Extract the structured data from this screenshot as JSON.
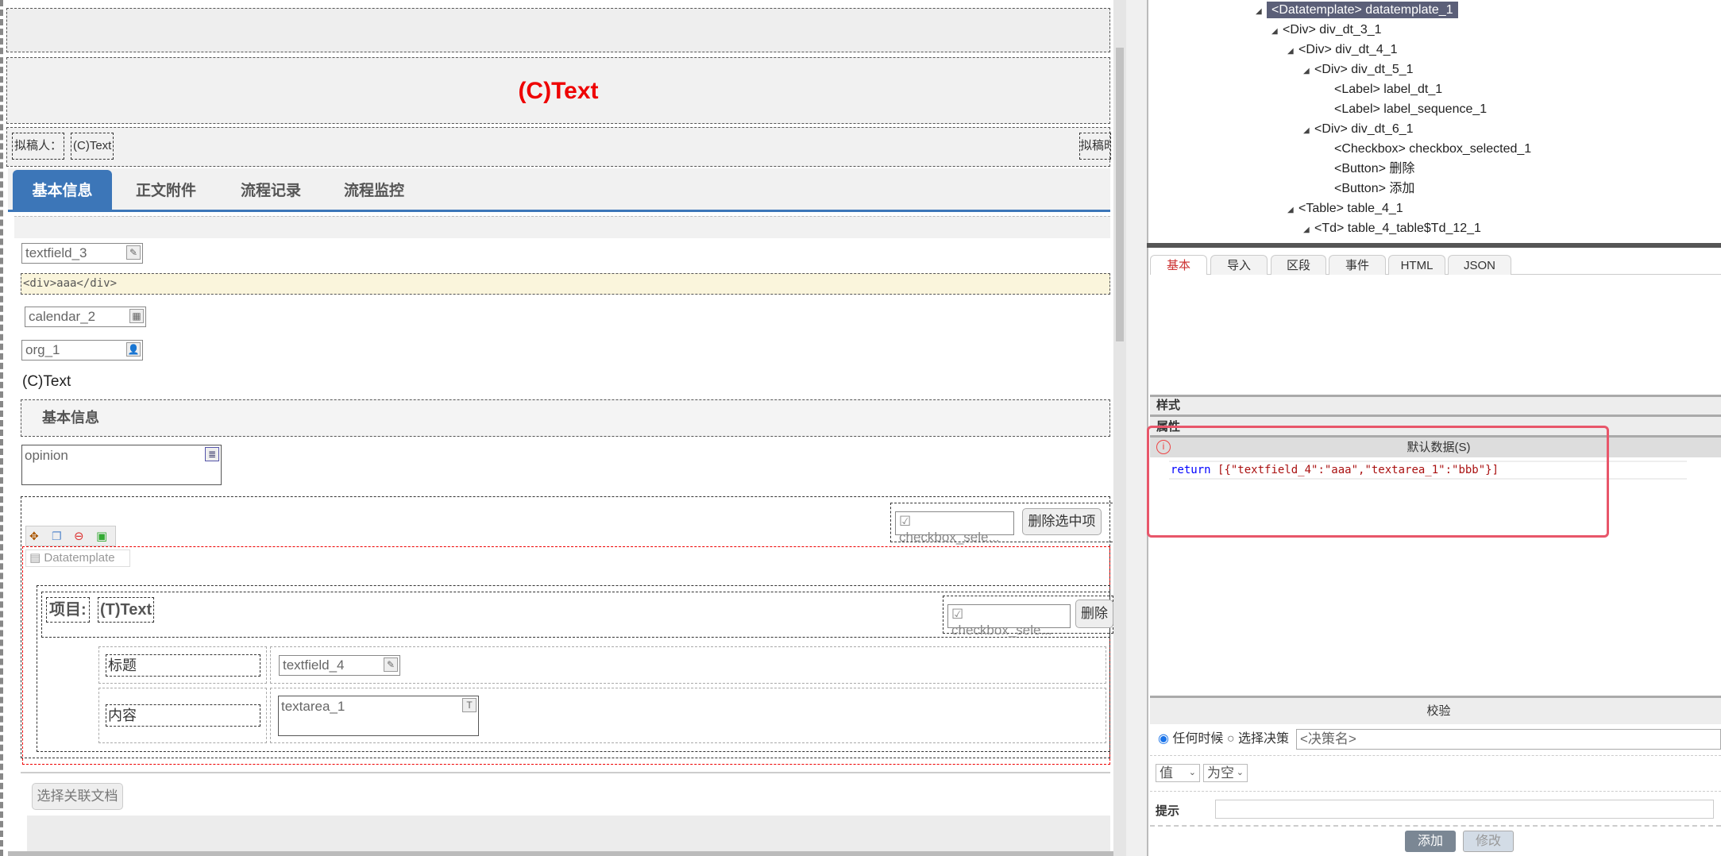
{
  "form": {
    "title": "(C)Text",
    "drafter_label": "拟稿人：",
    "drafter_value": "(C)Text",
    "draft_date_label": "拟稿时",
    "tabs": [
      {
        "label": "基本信息",
        "active": true
      },
      {
        "label": "正文附件"
      },
      {
        "label": "流程记录"
      },
      {
        "label": "流程监控"
      }
    ],
    "textfield_3": "textfield_3",
    "html_div": "<div>aaa</div>",
    "calendar": "calendar_2",
    "org": "org_1",
    "ctext": "(C)Text",
    "section_title": "基本信息",
    "opinion": "opinion",
    "checkbox_label": "checkbox_sele...",
    "delete_selected": "删除选中项",
    "datatemplate_label": "Datatemplate",
    "item_label": "项目:",
    "item_value": "(T)Text",
    "delete": "删除",
    "title_label": "标题",
    "textfield_4": "textfield_4",
    "content_label": "内容",
    "textarea_1": "textarea_1",
    "link_docs": "选择关联文档"
  },
  "tree": {
    "items": [
      {
        "text": "<Datatemplate> datatemplate_1",
        "selected": true
      },
      {
        "text": "<Div> div_dt_3_1"
      },
      {
        "text": "<Div> div_dt_4_1"
      },
      {
        "text": "<Div> div_dt_5_1"
      },
      {
        "text": "<Label> label_dt_1"
      },
      {
        "text": "<Label> label_sequence_1"
      },
      {
        "text": "<Div> div_dt_6_1"
      },
      {
        "text": "<Checkbox> checkbox_selected_1"
      },
      {
        "text": "<Button> 删除"
      },
      {
        "text": "<Button> 添加"
      },
      {
        "text": "<Table> table_4_1"
      },
      {
        "text": "<Td> table_4_table$Td_12_1"
      }
    ]
  },
  "props": {
    "tabs": [
      "基本",
      "导入",
      "区段",
      "事件",
      "HTML",
      "JSON"
    ],
    "style": "样式",
    "attr": "属性",
    "default_data": "默认数据(S)",
    "code": {
      "kw": "return",
      "body": "[{\"textfield_4\":\"aaa\",\"textarea_1\":\"bbb\"}]"
    },
    "validate": "校验",
    "radio_any": "任何时候",
    "radio_decision": "选择决策",
    "decision_placeholder": "<决策名>",
    "select_value": "值",
    "select_cond": "为空",
    "hint_label": "提示",
    "add": "添加",
    "modify": "修改",
    "highlight_color": "#e8566a",
    "accent": "#3c76b8"
  }
}
